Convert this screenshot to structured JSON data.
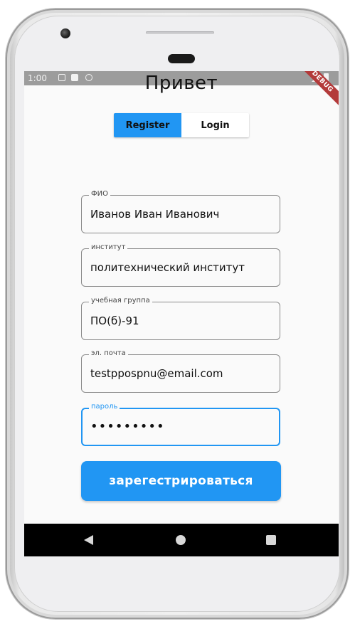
{
  "status_bar": {
    "time": "1:00",
    "debug_badge": "DEBUG"
  },
  "app": {
    "title": "Привет"
  },
  "toggle": {
    "register_label": "Register",
    "login_label": "Login",
    "active": "Register"
  },
  "form": {
    "fields": [
      {
        "label": "ФИО",
        "value": "Иванов Иван Иванович"
      },
      {
        "label": "институт",
        "value": "политехнический институт"
      },
      {
        "label": "учебная группа",
        "value": "ПО(б)-91"
      },
      {
        "label": "эл. почта",
        "value": "testpposрnu@email.com"
      },
      {
        "label": "пароль",
        "value": "•••••••••"
      }
    ],
    "submit_label": "зарегестрироваться"
  },
  "colors": {
    "accent": "#2196f3",
    "debug": "#b33a3a",
    "status_bar": "#9c9c9c"
  },
  "icons": [
    "camera",
    "speaker",
    "signal-icon",
    "battery-icon",
    "back-icon",
    "home-icon",
    "recents-icon"
  ]
}
